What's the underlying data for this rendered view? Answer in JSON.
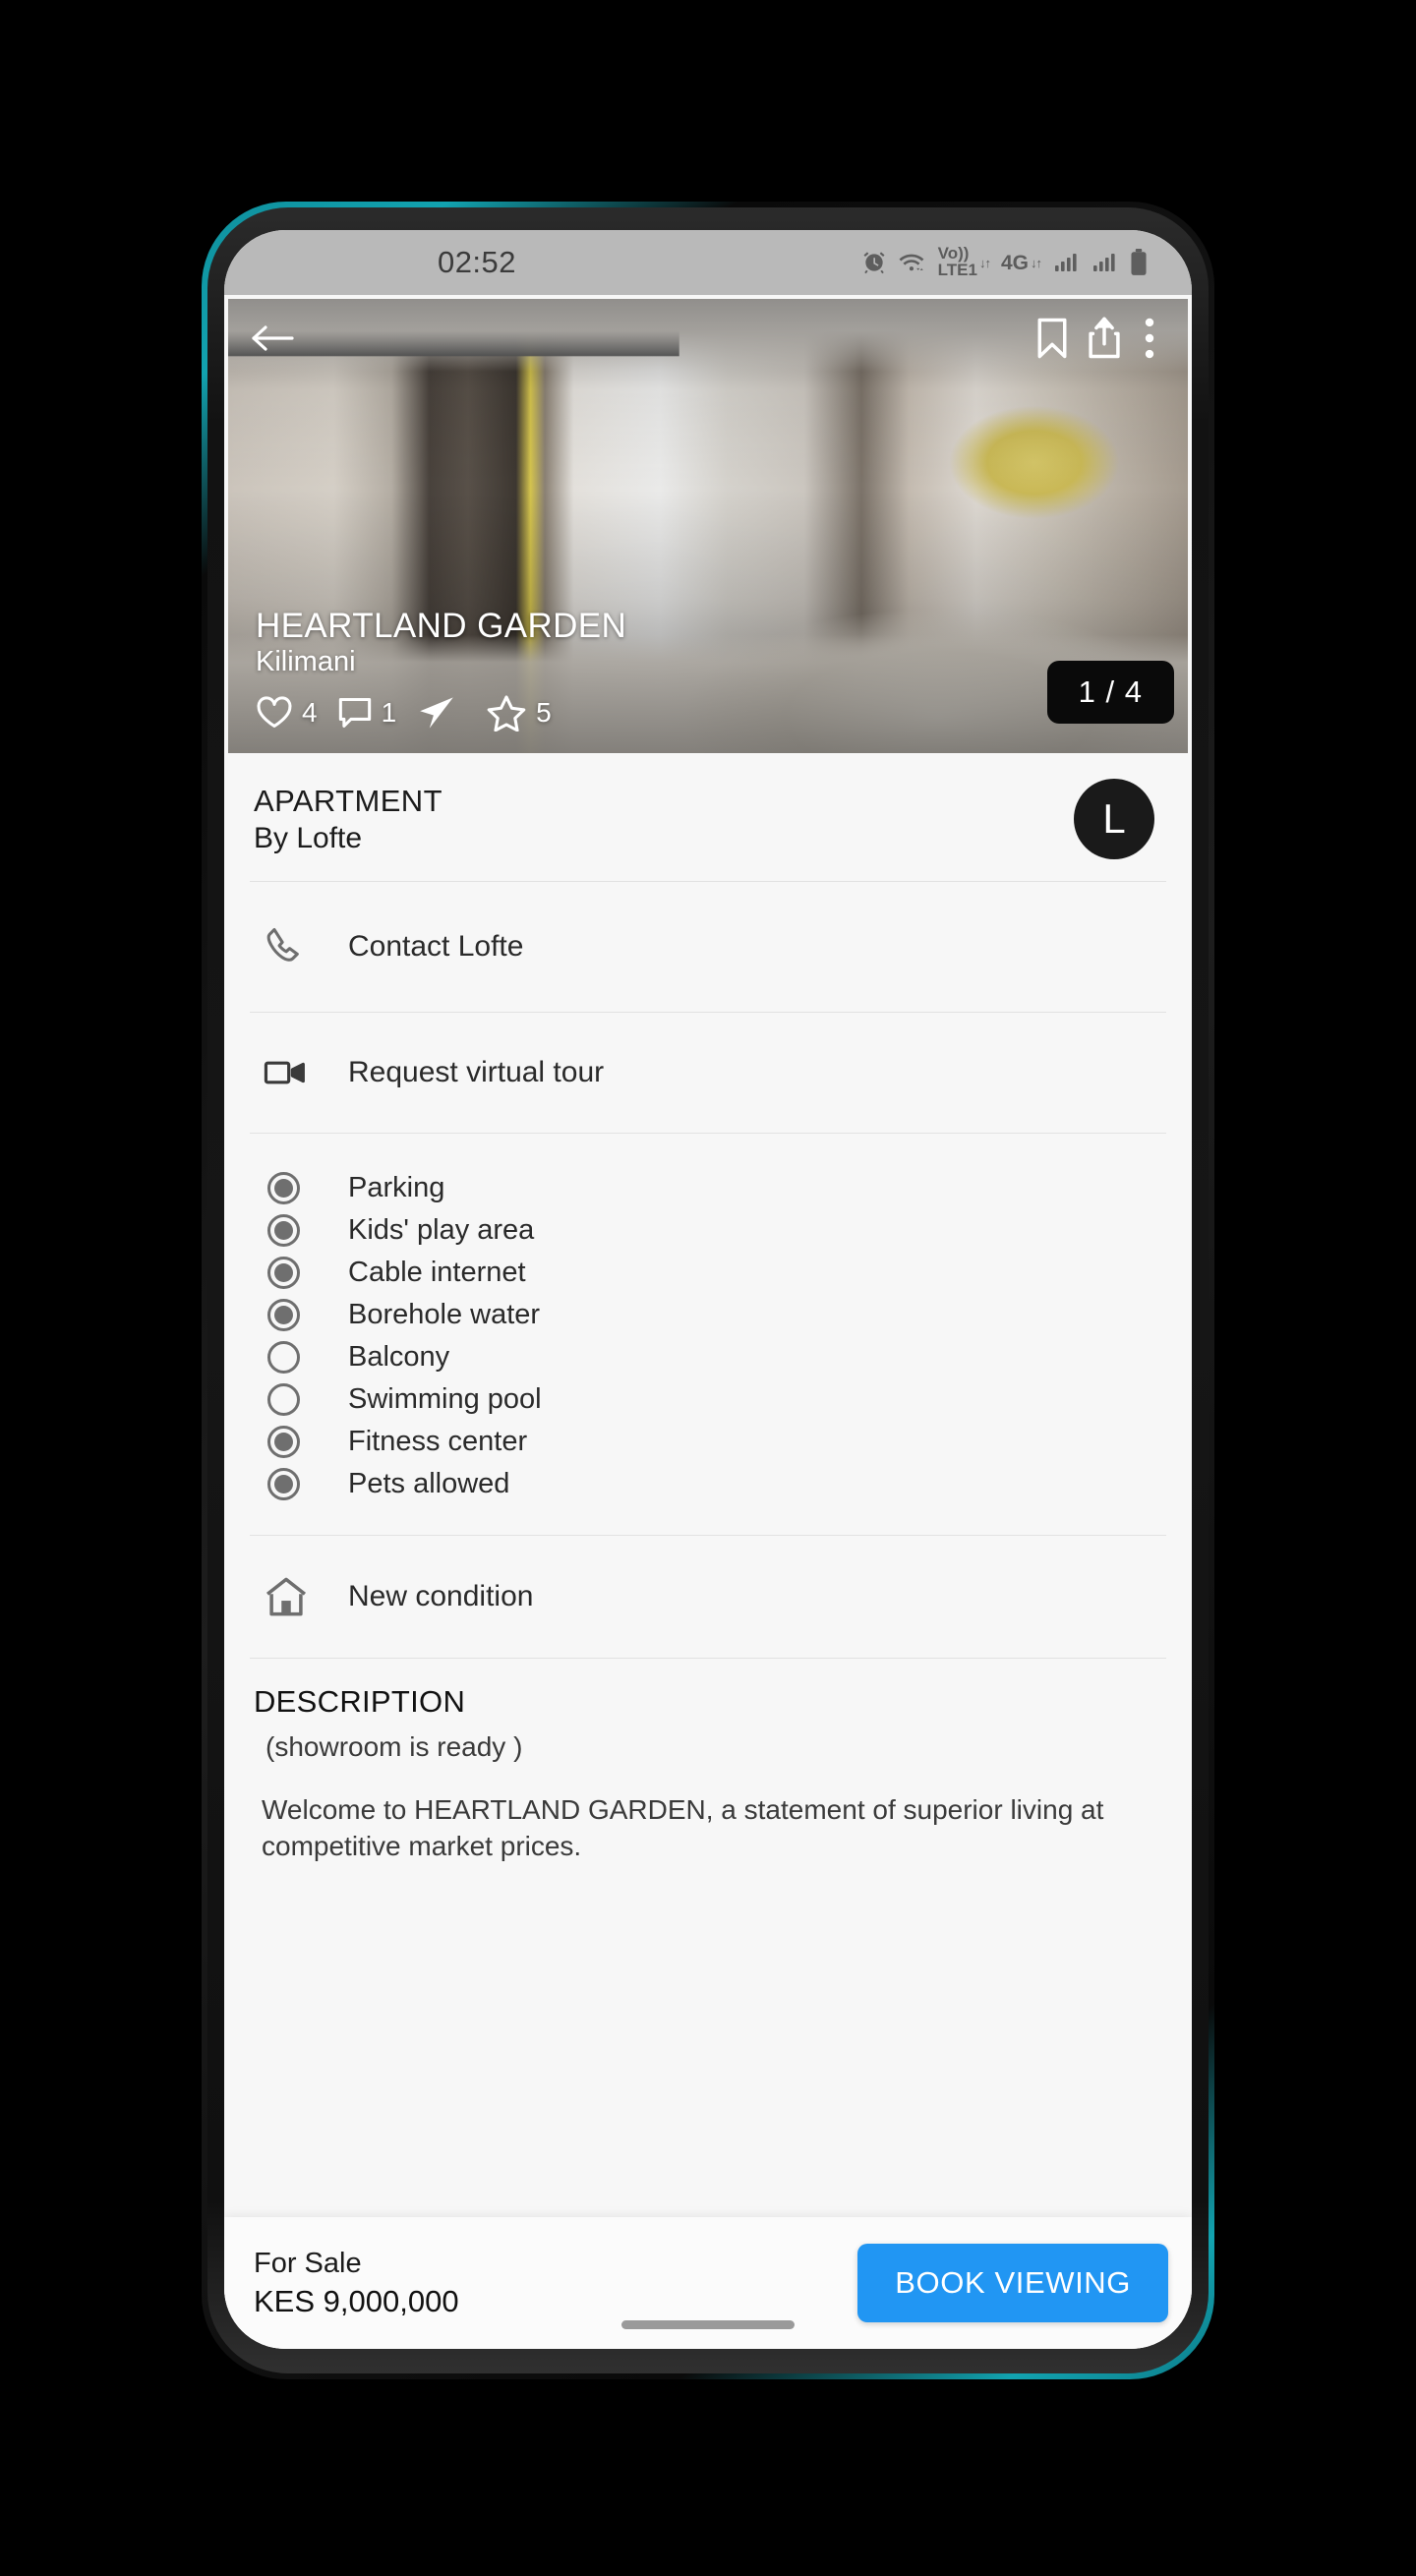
{
  "status_bar": {
    "time": "02:52",
    "icons": [
      {
        "name": "alarm-icon",
        "label": "alarm"
      },
      {
        "name": "wifi-icon",
        "label": "wifi"
      },
      {
        "name": "volte-icon",
        "label": "Vo))"
      },
      {
        "name": "lte-label",
        "label": "LTE1"
      },
      {
        "name": "network-4g-label",
        "label": "4G"
      },
      {
        "name": "signal-bars-1-icon",
        "label": "signal 1"
      },
      {
        "name": "signal-bars-2-icon",
        "label": "signal 2"
      },
      {
        "name": "battery-icon",
        "label": "battery"
      }
    ]
  },
  "hero": {
    "back_icon": "arrow-left-icon",
    "bookmark_icon": "bookmark-icon",
    "share_icon": "share-icon",
    "more_icon": "more-vertical-icon",
    "title": "HEARTLAND GARDEN",
    "subtitle": "Kilimani",
    "counter": "1 / 4",
    "stats": [
      {
        "icon": "heart-icon",
        "count": "4"
      },
      {
        "icon": "comment-icon",
        "count": "1"
      },
      {
        "icon": "send-icon",
        "count": ""
      },
      {
        "icon": "star-icon",
        "count": "5"
      }
    ]
  },
  "listing": {
    "type": "APARTMENT",
    "by": "By Lofte",
    "avatar_initial": "L"
  },
  "actions": [
    {
      "icon": "phone-icon",
      "label": "Contact Lofte"
    },
    {
      "icon": "video-camera-icon",
      "label": "Request virtual tour"
    }
  ],
  "amenities": [
    {
      "label": "Parking",
      "selected": true
    },
    {
      "label": "Kids' play area",
      "selected": true
    },
    {
      "label": "Cable internet",
      "selected": true
    },
    {
      "label": "Borehole water",
      "selected": true
    },
    {
      "label": "Balcony",
      "selected": false
    },
    {
      "label": "Swimming pool",
      "selected": false
    },
    {
      "label": "Fitness center",
      "selected": true
    },
    {
      "label": "Pets allowed",
      "selected": true
    }
  ],
  "condition": {
    "icon": "home-icon",
    "label": "New condition"
  },
  "description": {
    "heading": "DESCRIPTION",
    "note": "(showroom  is  ready )",
    "body": "Welcome to HEARTLAND GARDEN, a statement of superior living at competitive market prices."
  },
  "bottom_bar": {
    "status": "For Sale",
    "price": "KES 9,000,000",
    "cta_label": "BOOK VIEWING"
  },
  "colors": {
    "accent": "#2196f3",
    "frame_edge": "#12a3b0",
    "status_bar_bg": "#b9b9b9",
    "page_bg": "#f7f7f7",
    "avatar_bg": "#1a1a1a"
  }
}
